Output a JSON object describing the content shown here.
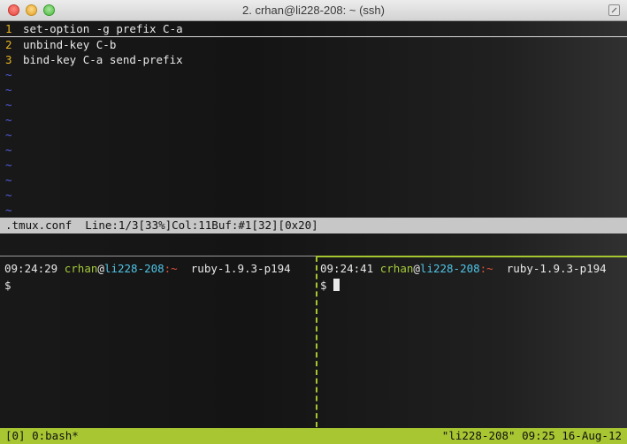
{
  "window": {
    "title": "2. crhan@li228-208: ~ (ssh)"
  },
  "vim": {
    "lines": [
      {
        "num": "1",
        "text": "set-option -g prefix C-a"
      },
      {
        "num": "2",
        "text": "unbind-key C-b"
      },
      {
        "num": "3",
        "text": "bind-key C-a send-prefix"
      }
    ],
    "tilde": "~",
    "status": ".tmux.conf  Line:1/3[33%]Col:11Buf:#1[32][0x20]"
  },
  "panes": [
    {
      "time": "09:24:29",
      "user": "crhan",
      "at": "@",
      "host": "li228-208",
      "path": ":~",
      "ruby": "ruby-1.9.3-p194",
      "prompt": "$"
    },
    {
      "time": "09:24:41",
      "user": "crhan",
      "at": "@",
      "host": "li228-208",
      "path": ":~",
      "ruby": "ruby-1.9.3-p194",
      "prompt": "$"
    }
  ],
  "tmux_status": {
    "left": "[0] 0:bash*",
    "right": "\"li228-208\" 09:25 16-Aug-12"
  },
  "colors": {
    "accent_green": "#a8c632",
    "host_cyan": "#4fc4e6",
    "path_red": "#e2513a",
    "line_number_yellow": "#e6b422",
    "tilde_blue": "#5560e6"
  }
}
